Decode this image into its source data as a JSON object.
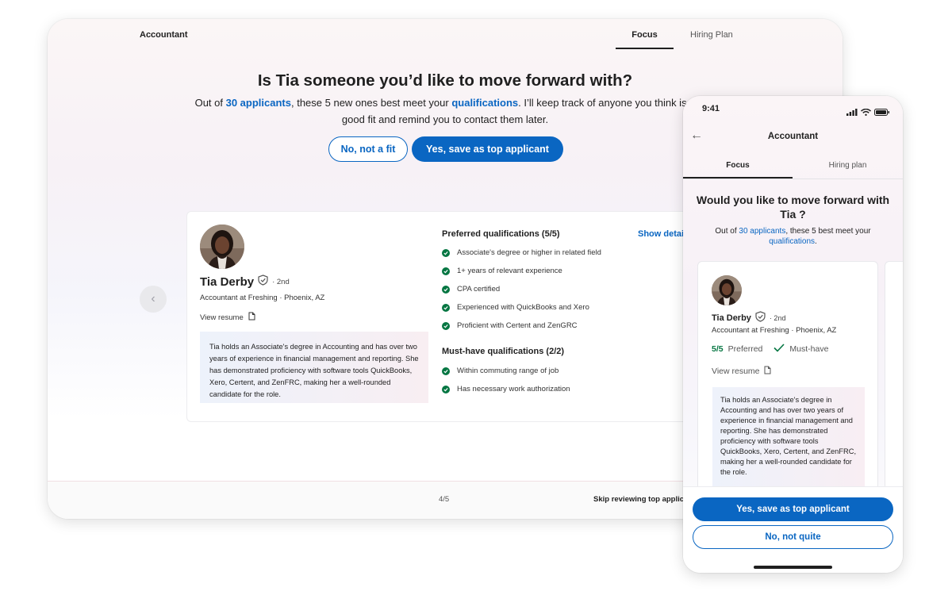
{
  "desktop": {
    "job_title": "Accountant",
    "tabs": [
      {
        "label": "Focus"
      },
      {
        "label": "Hiring Plan"
      }
    ],
    "question": "Is Tia someone you’d like to move forward with?",
    "subtitle": {
      "p1": "Out of ",
      "applicants_link": "30 applicants",
      "p2": ", these 5 new ones best meet your ",
      "qualifications_link": "qualifications",
      "p3": ". I’ll keep track of anyone you think is a good fit and remind you to contact them later."
    },
    "no_fit_button": "No, not a fit",
    "save_button": "Yes, save as top applicant",
    "candidate": {
      "name": "Tia Derby",
      "degree": "· 2nd",
      "role": "Accountant at Freshing · Phoenix, AZ",
      "view_resume": "View resume",
      "summary": "Tia holds an Associate's degree in Accounting and has over two years of experience in financial management and reporting. She has demonstrated proficiency with software tools QuickBooks, Xero, Certent, and ZenFRC, making her a well-rounded candidate for the role."
    },
    "preferred_heading": "Preferred qualifications (5/5)",
    "show_details": "Show details",
    "preferred": [
      "Associate's degree or higher in related field",
      "1+ years of relevant experience",
      "CPA certified",
      "Experienced with QuickBooks and Xero",
      "Proficient with Certent and ZenGRC"
    ],
    "must_have_heading": "Must-have qualifications (2/2)",
    "must_have": [
      "Within commuting range of job",
      "Has necessary work authorization"
    ],
    "pager": "4/5",
    "skip": "Skip reviewing top applicants"
  },
  "phone": {
    "time": "9:41",
    "title": "Accountant",
    "tabs": [
      {
        "label": "Focus"
      },
      {
        "label": "Hiring plan"
      }
    ],
    "question": "Would you like to move forward with Tia ?",
    "subtitle": {
      "p1": "Out of ",
      "applicants_link": "30 applicants",
      "p2": ", these 5 best meet your ",
      "qualifications_link": "qualifications",
      "p3": "."
    },
    "candidate": {
      "name": "Tia Derby",
      "degree": "· 2nd",
      "role": "Accountant at Freshing · Phoenix, AZ",
      "preferred_count": "5/5",
      "preferred_label": "Preferred",
      "must_have_label": "Must-have",
      "view_resume": "View resume",
      "summary": "Tia holds an Associate's degree in Accounting and has over two years of experience in financial management and reporting. She has demonstrated proficiency with software tools QuickBooks, Xero, Certent, and ZenFRC, making her a well-rounded candidate for the role."
    },
    "save_button": "Yes, save as top applicant",
    "not_quite_button": "No, not quite"
  },
  "colors": {
    "primary": "#0a66c2",
    "success": "#057642",
    "text": "#1f1f1f"
  }
}
